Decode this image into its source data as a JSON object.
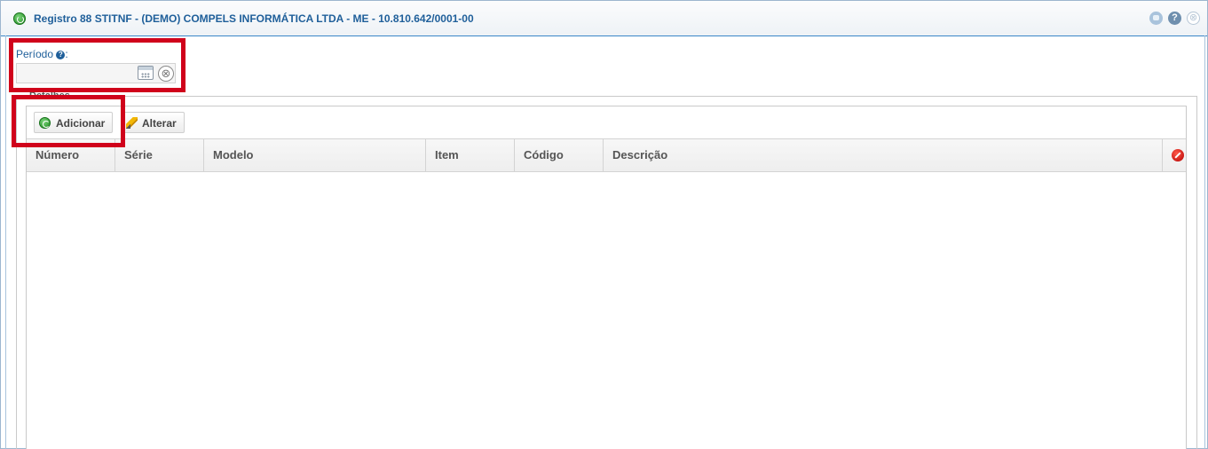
{
  "window": {
    "title": "Registro 88 STITNF - (DEMO) COMPELS INFORMÁTICA LTDA - ME - 10.810.642/0001-00",
    "help_glyph": "?",
    "close_glyph": "⊗"
  },
  "periodo": {
    "label": "Período",
    "help_glyph": "?",
    "label_suffix": ":",
    "value": "",
    "clear_glyph": "⊗"
  },
  "detalhes": {
    "legend": "Detalhes"
  },
  "toolbar": {
    "add_label": "Adicionar",
    "edit_label": "Alterar"
  },
  "grid": {
    "columns": [
      "Número",
      "Série",
      "Modelo",
      "Item",
      "Código",
      "Descrição"
    ],
    "rows": []
  },
  "colors": {
    "accent": "#1f5f9a",
    "highlight": "#d0021b",
    "add_green": "#1f8a1f",
    "remove_red": "#b50000"
  },
  "icons": {
    "title": "add-circle-icon",
    "minimize": "minimize-icon",
    "help": "help-icon",
    "close": "close-icon",
    "calendar": "calendar-icon",
    "clear": "clear-icon",
    "add": "add-circle-icon",
    "edit": "pencil-icon",
    "remove": "remove-circle-icon"
  }
}
